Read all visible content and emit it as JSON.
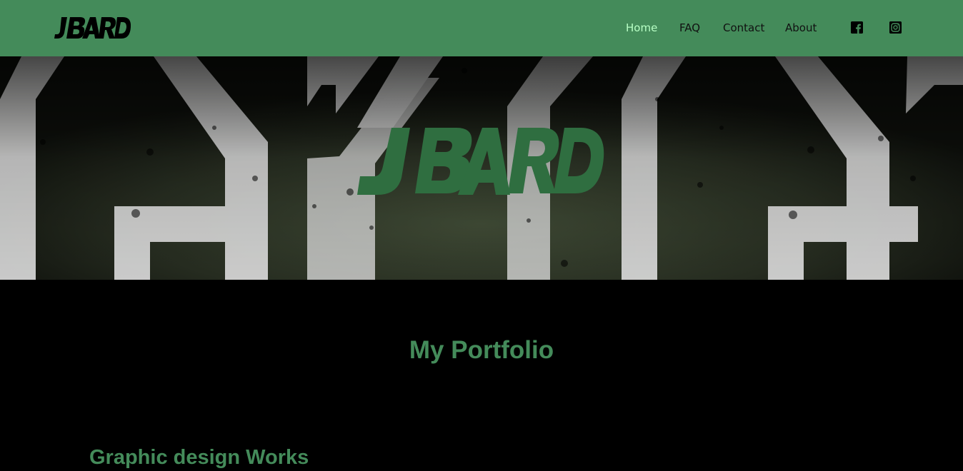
{
  "brand": {
    "logo_text": "JBARD",
    "color": "#448b5a"
  },
  "nav": {
    "items": [
      {
        "label": "Home",
        "active": true
      },
      {
        "label": "FAQ",
        "active": false
      },
      {
        "label": "Contact",
        "active": false
      },
      {
        "label": "About",
        "active": false
      }
    ],
    "social": [
      {
        "icon": "facebook-icon"
      },
      {
        "icon": "instagram-icon"
      }
    ]
  },
  "hero": {
    "logo_text": "JBARD"
  },
  "main": {
    "title": "My Portfolio",
    "section_title": "Graphic design Works"
  },
  "colors": {
    "header_bg": "#448b5a",
    "page_bg": "#000000",
    "active_link": "#b8ffc5",
    "heading": "#448b5a"
  }
}
